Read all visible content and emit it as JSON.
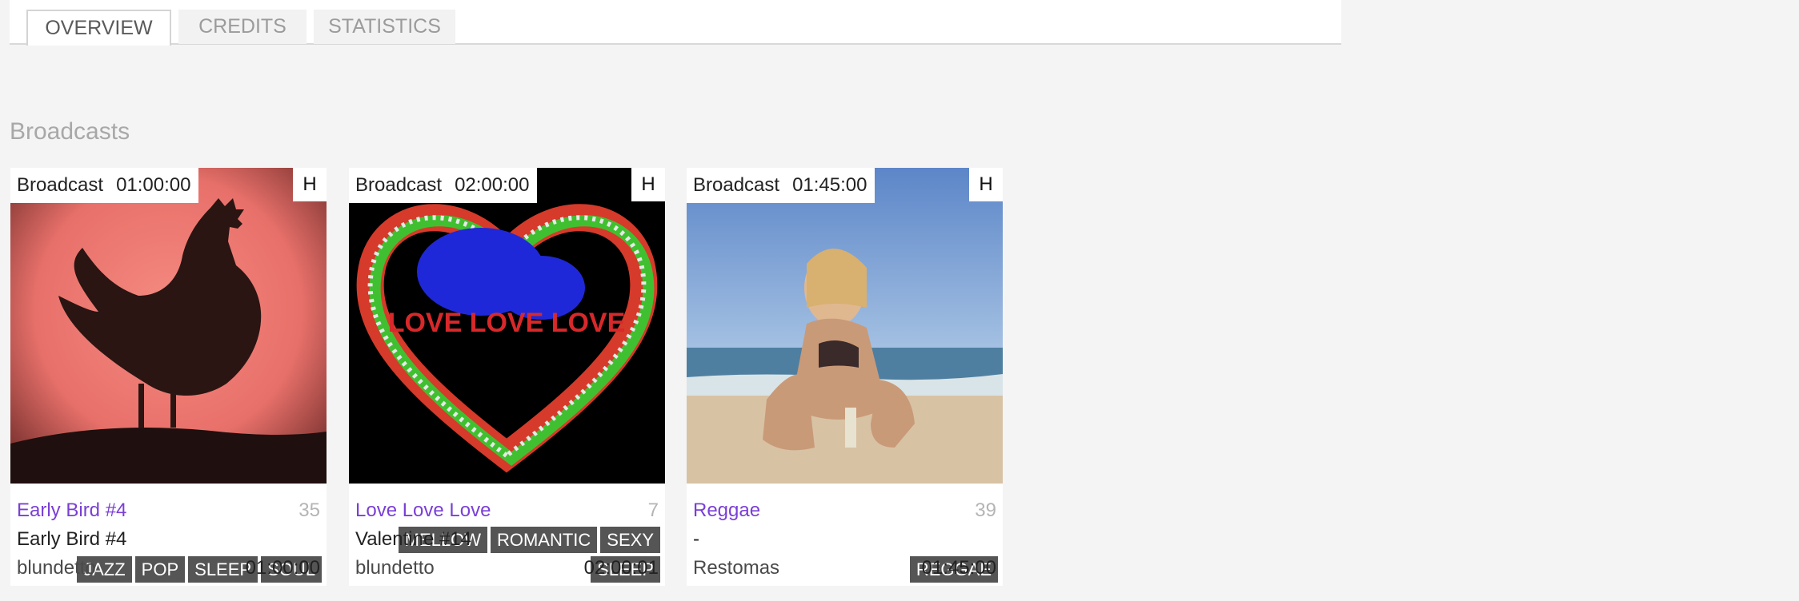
{
  "tabs": [
    {
      "label": "OVERVIEW",
      "active": true
    },
    {
      "label": "CREDITS",
      "active": false
    },
    {
      "label": "STATISTICS",
      "active": false
    }
  ],
  "section_title": "Broadcasts",
  "cards": [
    {
      "label": "Broadcast",
      "duration_badge": "01:00:00",
      "h_label": "H",
      "image_icon": "rooster-image",
      "tags": [
        "JAZZ",
        "POP",
        "SLEEP",
        "SOUL"
      ],
      "title": "Early Bird #4",
      "count": "35",
      "subtitle": "Early Bird #4",
      "user": "blundetto",
      "length": "01:00:00"
    },
    {
      "label": "Broadcast",
      "duration_badge": "02:00:00",
      "h_label": "H",
      "image_icon": "heart-image",
      "image_text": "LOVE LOVE LOVE",
      "tags": [
        "MELLOW",
        "ROMANTIC",
        "SEXY",
        "SLEEP"
      ],
      "title": "Love Love Love",
      "count": "7",
      "subtitle": "Valentine #14",
      "user": "blundetto",
      "length": "02:00:01"
    },
    {
      "label": "Broadcast",
      "duration_badge": "01:45:00",
      "h_label": "H",
      "image_icon": "beach-image",
      "tags": [
        "REGGAE"
      ],
      "title": "Reggae",
      "count": "39",
      "subtitle": "-",
      "user": "Restomas",
      "length": "01:45:00"
    }
  ],
  "colors": {
    "page_bg": "#f4f4f4",
    "link": "#7a3fd6",
    "tag_bg": "#555555",
    "count": "#b4b4b4"
  }
}
